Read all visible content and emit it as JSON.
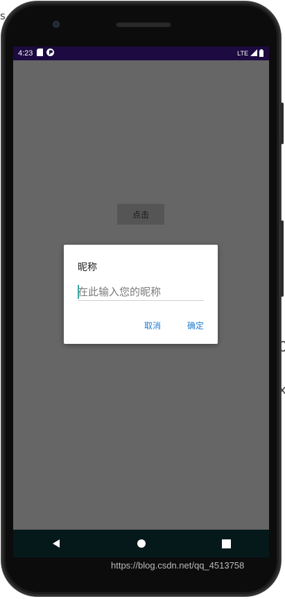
{
  "status_bar": {
    "time": "4:23",
    "network": "LTE"
  },
  "main": {
    "click_button_label": "点击"
  },
  "dialog": {
    "title": "昵称",
    "input_placeholder": "在此输入您的昵称",
    "input_value": "",
    "cancel_label": "取消",
    "ok_label": "确定"
  },
  "nav": {
    "items": [
      "back",
      "home",
      "recents"
    ]
  },
  "watermark": "https://blog.csdn.net/qq_4513758",
  "colors": {
    "status_bar": "#1c0a40",
    "screen_overlay": "#666666",
    "accent": "#1e7bd0",
    "nav_bar": "#05191b"
  }
}
